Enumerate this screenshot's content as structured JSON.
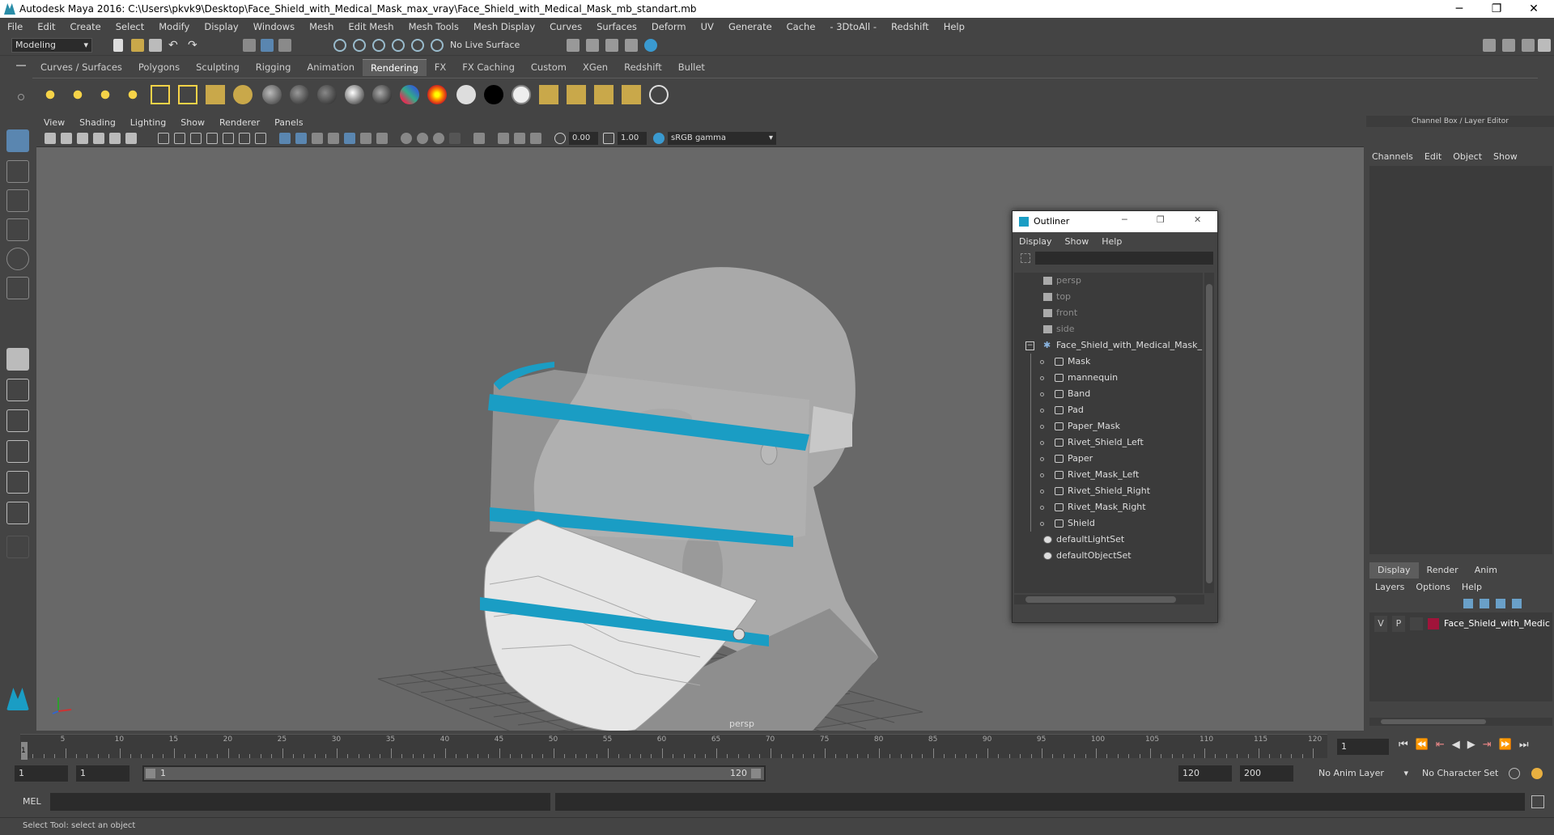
{
  "window": {
    "title": "Autodesk Maya 2016: C:\\Users\\pkvk9\\Desktop\\Face_Shield_with_Medical_Mask_max_vray\\Face_Shield_with_Medical_Mask_mb_standart.mb",
    "minimize": "─",
    "maximize": "❐",
    "close": "✕"
  },
  "menubar": [
    "File",
    "Edit",
    "Create",
    "Select",
    "Modify",
    "Display",
    "Windows",
    "Mesh",
    "Edit Mesh",
    "Mesh Tools",
    "Mesh Display",
    "Curves",
    "Surfaces",
    "Deform",
    "UV",
    "Generate",
    "Cache",
    "- 3DtoAll -",
    "Redshift",
    "Help"
  ],
  "statusline": {
    "mode": "Modeling",
    "live_surface": "No Live Surface"
  },
  "shelf_tabs": [
    {
      "label": "Curves / Surfaces"
    },
    {
      "label": "Polygons"
    },
    {
      "label": "Sculpting"
    },
    {
      "label": "Rigging"
    },
    {
      "label": "Animation"
    },
    {
      "label": "Rendering",
      "active": true
    },
    {
      "label": "FX"
    },
    {
      "label": "FX Caching"
    },
    {
      "label": "Custom"
    },
    {
      "label": "XGen"
    },
    {
      "label": "Redshift"
    },
    {
      "label": "Bullet"
    }
  ],
  "viewport": {
    "menu": [
      "View",
      "Shading",
      "Lighting",
      "Show",
      "Renderer",
      "Panels"
    ],
    "exposure": "0.00",
    "gamma": "1.00",
    "color_space": "sRGB gamma",
    "camera_label": "persp"
  },
  "outliner": {
    "title": "Outliner",
    "menu": [
      "Display",
      "Show",
      "Help"
    ],
    "items": [
      {
        "label": "persp",
        "kind": "camera",
        "dim": true
      },
      {
        "label": "top",
        "kind": "camera",
        "dim": true
      },
      {
        "label": "front",
        "kind": "camera",
        "dim": true
      },
      {
        "label": "side",
        "kind": "camera",
        "dim": true
      },
      {
        "label": "Face_Shield_with_Medical_Mask_r",
        "kind": "group"
      },
      {
        "label": "Mask",
        "kind": "mesh"
      },
      {
        "label": "mannequin",
        "kind": "mesh"
      },
      {
        "label": "Band",
        "kind": "mesh"
      },
      {
        "label": "Pad",
        "kind": "mesh"
      },
      {
        "label": "Paper_Mask",
        "kind": "mesh"
      },
      {
        "label": "Rivet_Shield_Left",
        "kind": "mesh"
      },
      {
        "label": "Paper",
        "kind": "mesh"
      },
      {
        "label": "Rivet_Mask_Left",
        "kind": "mesh"
      },
      {
        "label": "Rivet_Shield_Right",
        "kind": "mesh"
      },
      {
        "label": "Rivet_Mask_Right",
        "kind": "mesh"
      },
      {
        "label": "Shield",
        "kind": "mesh"
      },
      {
        "label": "defaultLightSet",
        "kind": "set"
      },
      {
        "label": "defaultObjectSet",
        "kind": "set"
      }
    ]
  },
  "channel_box": {
    "title": "Channel Box / Layer Editor",
    "menu": [
      "Channels",
      "Edit",
      "Object",
      "Show"
    ],
    "layer_tabs": [
      {
        "label": "Display",
        "active": true
      },
      {
        "label": "Render"
      },
      {
        "label": "Anim"
      }
    ],
    "layer_menu": [
      "Layers",
      "Options",
      "Help"
    ],
    "layer": {
      "v": "V",
      "p": "P",
      "name": "Face_Shield_with_Medic",
      "color": "#a0143a"
    }
  },
  "timeline": {
    "ticks": [
      "5",
      "10",
      "15",
      "20",
      "25",
      "30",
      "35",
      "40",
      "45",
      "50",
      "55",
      "60",
      "65",
      "70",
      "75",
      "80",
      "85",
      "90",
      "95",
      "100",
      "105",
      "110",
      "115",
      "120"
    ],
    "current_frame_marker": "1",
    "current_frame": "1"
  },
  "range": {
    "start": "1",
    "playback_start": "1",
    "slider_start": "1",
    "slider_end": "120",
    "playback_end": "120",
    "end": "200",
    "anim_layer": "No Anim Layer",
    "character_set": "No Character Set"
  },
  "command_line": {
    "label": "MEL"
  },
  "help_line": "Select Tool: select an object",
  "colors": {
    "accent": "#1a9dc4",
    "selected_tool": "#5a86b0",
    "layer": "#a0143a"
  }
}
